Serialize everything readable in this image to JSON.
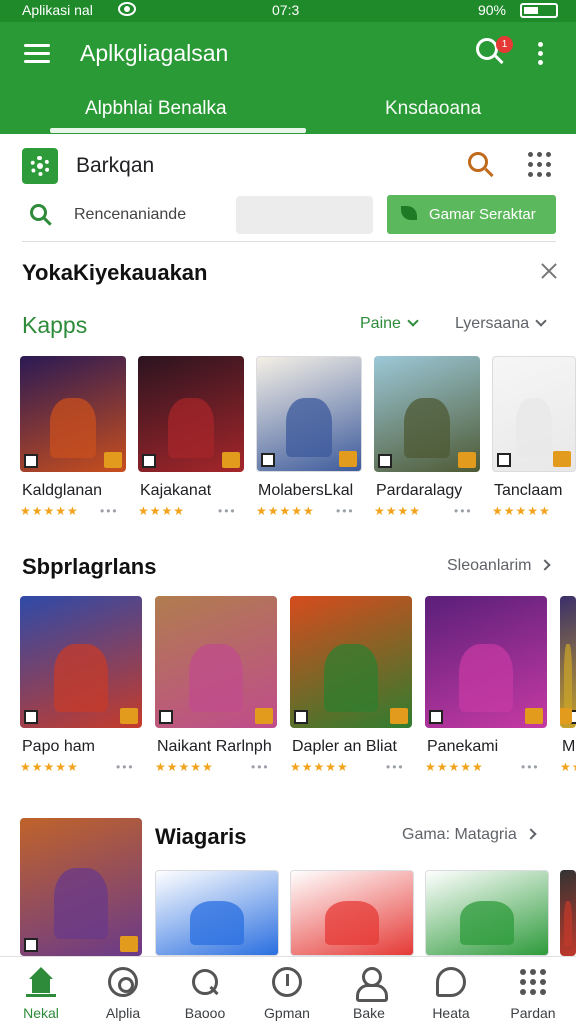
{
  "status_bar": {
    "left": "Aplikasi nal",
    "center": "07:3",
    "right": "90%"
  },
  "app_bar": {
    "title": "Aplkgliagalsan",
    "notification_count": "1"
  },
  "tabs": [
    {
      "label": "Alpbhlai Benalka"
    },
    {
      "label": "Knsdaoana"
    }
  ],
  "search_card": {
    "title": "Barkqan",
    "search_placeholder": "Rencenaniande",
    "button_label": "Gamar Seraktar"
  },
  "section_1": {
    "title": "YokaKiyekauakan",
    "subtitle": "Kapps",
    "filter_1": "Paine",
    "filter_2": "Lyersaana",
    "apps": [
      {
        "name": "Kaldglanan",
        "stars": "★★★★★",
        "colors": [
          "#2a1a55",
          "#c94f1d"
        ]
      },
      {
        "name": "Kajakanat",
        "stars": "★★★★",
        "colors": [
          "#2b1420",
          "#a5262a"
        ]
      },
      {
        "name": "MolabersLkal",
        "stars": "★★★★★",
        "colors": [
          "#f5f0e6",
          "#3c5a9c"
        ]
      },
      {
        "name": "Pardaralagy",
        "stars": "★★★★",
        "colors": [
          "#9cc8d8",
          "#4e5a34"
        ]
      },
      {
        "name": "Tanclaam",
        "stars": "★★★★★",
        "colors": [
          "#f6f6f6",
          "#e8e8e8"
        ]
      }
    ]
  },
  "section_2": {
    "title": "Sbprlagrlans",
    "see_all": "Sleoanlarim",
    "apps": [
      {
        "name": "Papo ham",
        "stars": "★★★★★",
        "colors": [
          "#2e4aa8",
          "#c63b2a"
        ]
      },
      {
        "name": "Naikant Rarlnph",
        "stars": "★★★★★",
        "colors": [
          "#b07d4e",
          "#c04c8c"
        ]
      },
      {
        "name": "Dapler an Bliat",
        "stars": "★★★★★",
        "colors": [
          "#d64b1e",
          "#2f7d2f"
        ]
      },
      {
        "name": "Panekami",
        "stars": "★★★★★",
        "colors": [
          "#5a1f7a",
          "#c63aa3"
        ]
      },
      {
        "name": "Ma",
        "stars": "★★",
        "colors": [
          "#3a2f6a",
          "#c8a32a"
        ]
      }
    ]
  },
  "section_3": {
    "title": "Wiagaris",
    "see_all": "Gama: Matagria",
    "apps": [
      {
        "name": "",
        "colors": [
          "#c0632a",
          "#6a3a8a"
        ]
      },
      {
        "name": "",
        "colors": [
          "#ffffff",
          "#2a6fe0"
        ]
      },
      {
        "name": "",
        "colors": [
          "#ffffff",
          "#e53935"
        ]
      },
      {
        "name": "",
        "colors": [
          "#ffffff",
          "#2e9b3b"
        ]
      },
      {
        "name": "",
        "colors": [
          "#333333",
          "#c0392b"
        ]
      }
    ]
  },
  "bottom_nav": [
    {
      "label": "Nekal",
      "icon": "home-icon",
      "active": true
    },
    {
      "label": "Alplia",
      "icon": "target-icon"
    },
    {
      "label": "Baooo",
      "icon": "search-icon"
    },
    {
      "label": "Gpman",
      "icon": "clock-icon"
    },
    {
      "label": "Bake",
      "icon": "person-icon"
    },
    {
      "label": "Heata",
      "icon": "chat-icon"
    },
    {
      "label": "Pardan",
      "icon": "grid-icon"
    }
  ]
}
